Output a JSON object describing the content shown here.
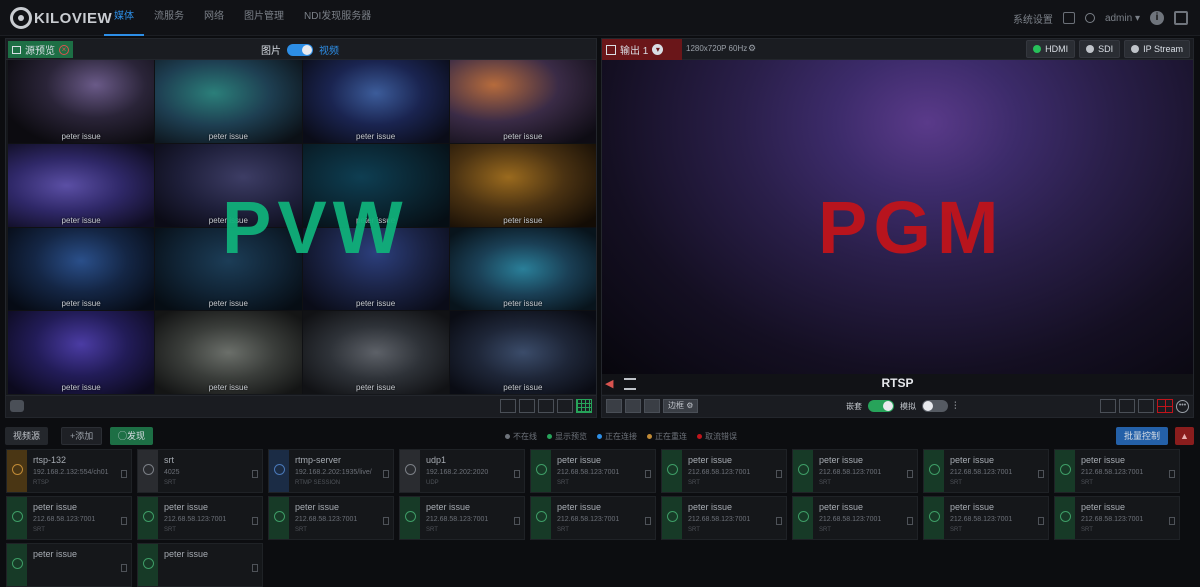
{
  "app": {
    "logo": "KILOVIEW"
  },
  "nav": [
    "媒体",
    "流服务",
    "网络",
    "图片管理",
    "NDI发现服务器"
  ],
  "topright": {
    "settings": "系统设置",
    "user": "admin",
    "help": "i"
  },
  "pvw": {
    "source_preview": "源预览",
    "toggle_left": "图片",
    "toggle_right": "视频",
    "overlay": "PVW",
    "tiles": [
      "peter issue",
      "peter issue",
      "peter issue",
      "peter issue",
      "peter issue",
      "peter issue",
      "peter issue",
      "peter issue",
      "peter issue",
      "peter issue",
      "peter issue",
      "peter issue",
      "peter issue",
      "peter issue",
      "peter issue",
      "peter issue"
    ]
  },
  "pgm": {
    "output": "输出 1",
    "resolution": "1280x720P 60Hz",
    "buttons": [
      "HDMI",
      "SDI",
      "IP Stream"
    ],
    "overlay": "PGM",
    "source": "RTSP",
    "border_btn": "边框",
    "toggle1": "嵌套",
    "toggle2": "模拟"
  },
  "srcbar": {
    "tab": "视频源",
    "add": "+添加",
    "discover": "◯发现",
    "legend": [
      "不在线",
      "显示预览",
      "正在连接",
      "正在重连",
      "取流错误"
    ],
    "control": "批量控制"
  },
  "sources": [
    {
      "name": "rtsp-132",
      "addr": "192.168.2.132:554/ch01",
      "sub": "RTSP",
      "type": "orange"
    },
    {
      "name": "srt",
      "addr": "4025",
      "sub": "SRT",
      "type": "gray"
    },
    {
      "name": "rtmp-server",
      "addr": "192.168.2.202:1935/live/",
      "sub": "RTMP SESSION",
      "type": "blue"
    },
    {
      "name": "udp1",
      "addr": "192.168.2.202:2020",
      "sub": "UDP",
      "type": "gray"
    },
    {
      "name": "peter issue",
      "addr": "212.68.58.123:7001",
      "sub": "SRT",
      "type": "green"
    },
    {
      "name": "peter issue",
      "addr": "212.68.58.123:7001",
      "sub": "SRT",
      "type": "green"
    },
    {
      "name": "peter issue",
      "addr": "212.68.58.123:7001",
      "sub": "SRT",
      "type": "green"
    },
    {
      "name": "peter issue",
      "addr": "212.68.58.123:7001",
      "sub": "SRT",
      "type": "green"
    },
    {
      "name": "peter issue",
      "addr": "212.68.58.123:7001",
      "sub": "SRT",
      "type": "green"
    },
    {
      "name": "peter issue",
      "addr": "212.68.58.123:7001",
      "sub": "SRT",
      "type": "green"
    },
    {
      "name": "peter issue",
      "addr": "212.68.58.123:7001",
      "sub": "SRT",
      "type": "green"
    },
    {
      "name": "peter issue",
      "addr": "212.68.58.123:7001",
      "sub": "SRT",
      "type": "green"
    },
    {
      "name": "peter issue",
      "addr": "212.68.58.123:7001",
      "sub": "SRT",
      "type": "green"
    },
    {
      "name": "peter issue",
      "addr": "212.68.58.123:7001",
      "sub": "SRT",
      "type": "green"
    },
    {
      "name": "peter issue",
      "addr": "212.68.58.123:7001",
      "sub": "SRT",
      "type": "green"
    },
    {
      "name": "peter issue",
      "addr": "212.68.58.123:7001",
      "sub": "SRT",
      "type": "green"
    },
    {
      "name": "peter issue",
      "addr": "212.68.58.123:7001",
      "sub": "SRT",
      "type": "green"
    },
    {
      "name": "peter issue",
      "addr": "212.68.58.123:7001",
      "sub": "SRT",
      "type": "green"
    },
    {
      "name": "peter issue",
      "addr": "",
      "sub": "",
      "type": "green"
    },
    {
      "name": "peter issue",
      "addr": "",
      "sub": "",
      "type": "green"
    }
  ],
  "colors": {
    "accent": "#2d8ee6",
    "pvw": "#10b07a",
    "pgm": "#c0141b"
  }
}
